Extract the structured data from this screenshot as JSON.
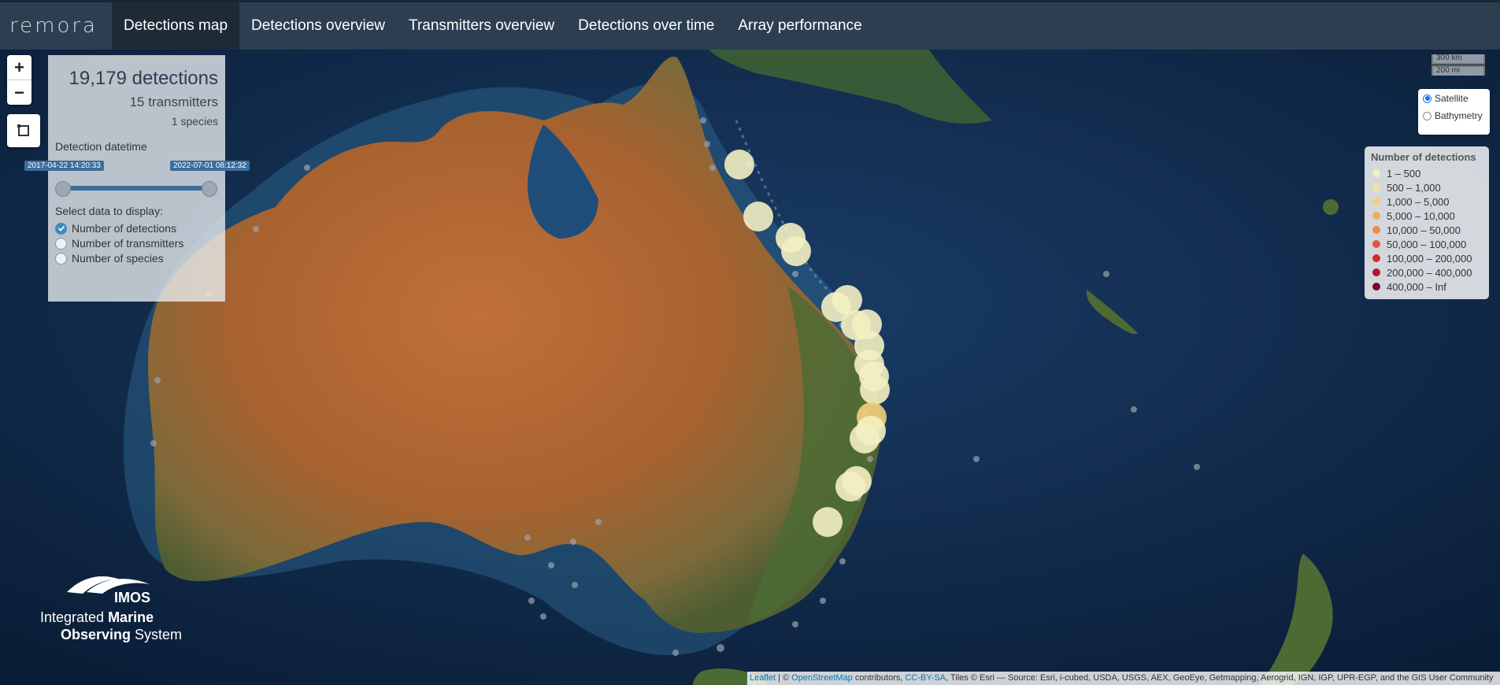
{
  "app": {
    "logo_text": "remora"
  },
  "nav": {
    "tabs": [
      {
        "label": "Detections map",
        "active": true
      },
      {
        "label": "Detections overview",
        "active": false
      },
      {
        "label": "Transmitters overview",
        "active": false
      },
      {
        "label": "Detections over time",
        "active": false
      },
      {
        "label": "Array performance",
        "active": false
      }
    ]
  },
  "map_controls": {
    "zoom_in": "+",
    "zoom_out": "−",
    "draw_tool_icon": "draw-rectangle-icon"
  },
  "summary": {
    "detections": "19,179 detections",
    "transmitters": "15 transmitters",
    "species": "1 species",
    "datetime_label": "Detection datetime",
    "date_from": "2017-04-22 14:20:33",
    "date_to": "2022-07-01 08:12:32",
    "range_fraction": [
      0.0,
      1.0
    ],
    "select_label": "Select data to display:",
    "options": [
      {
        "label": "Number of detections",
        "checked": true
      },
      {
        "label": "Number of transmitters",
        "checked": false
      },
      {
        "label": "Number of species",
        "checked": false
      }
    ]
  },
  "scale": {
    "km": "300 km",
    "mi": "200 mi"
  },
  "base_layers": [
    {
      "label": "Satellite",
      "selected": true
    },
    {
      "label": "Bathymetry",
      "selected": false
    }
  ],
  "legend": {
    "title": "Number of detections",
    "items": [
      {
        "label": "1 – 500",
        "color": "#f3efc2"
      },
      {
        "label": "500 – 1,000",
        "color": "#efe3a0"
      },
      {
        "label": "1,000 – 5,000",
        "color": "#f2cf7d"
      },
      {
        "label": "5,000 – 10,000",
        "color": "#f1ac5d"
      },
      {
        "label": "10,000 – 50,000",
        "color": "#ee8a47"
      },
      {
        "label": "50,000 – 100,000",
        "color": "#e5553a"
      },
      {
        "label": "100,000 – 200,000",
        "color": "#d22b2b"
      },
      {
        "label": "200,000 – 400,000",
        "color": "#b31530"
      },
      {
        "label": "400,000 – Inf",
        "color": "#7a0532"
      }
    ]
  },
  "logo": {
    "mark": "IMOS",
    "line1_a": "Integrated ",
    "line1_b": "Marine",
    "line2_a": "Observing",
    "line2_b": " System"
  },
  "attribution": {
    "leaflet": "Leaflet",
    "sep": " | © ",
    "osm": "OpenStreetMap",
    "contrib": " contributors, ",
    "license": "CC-BY-SA",
    "tiles": ", Tiles © Esri — Source: Esri, i-cubed, USDA, USGS, AEX, GeoEye, Getmapping, Aerogrid, IGN, IGP, UPR-EGP, and the GIS User Community"
  },
  "colors": {
    "navbar": "#2c3e50",
    "active_tab": "#1e2b37",
    "accent": "#3c8dbc",
    "slider": "#3d6d9c",
    "ocean": "#0c2340"
  }
}
